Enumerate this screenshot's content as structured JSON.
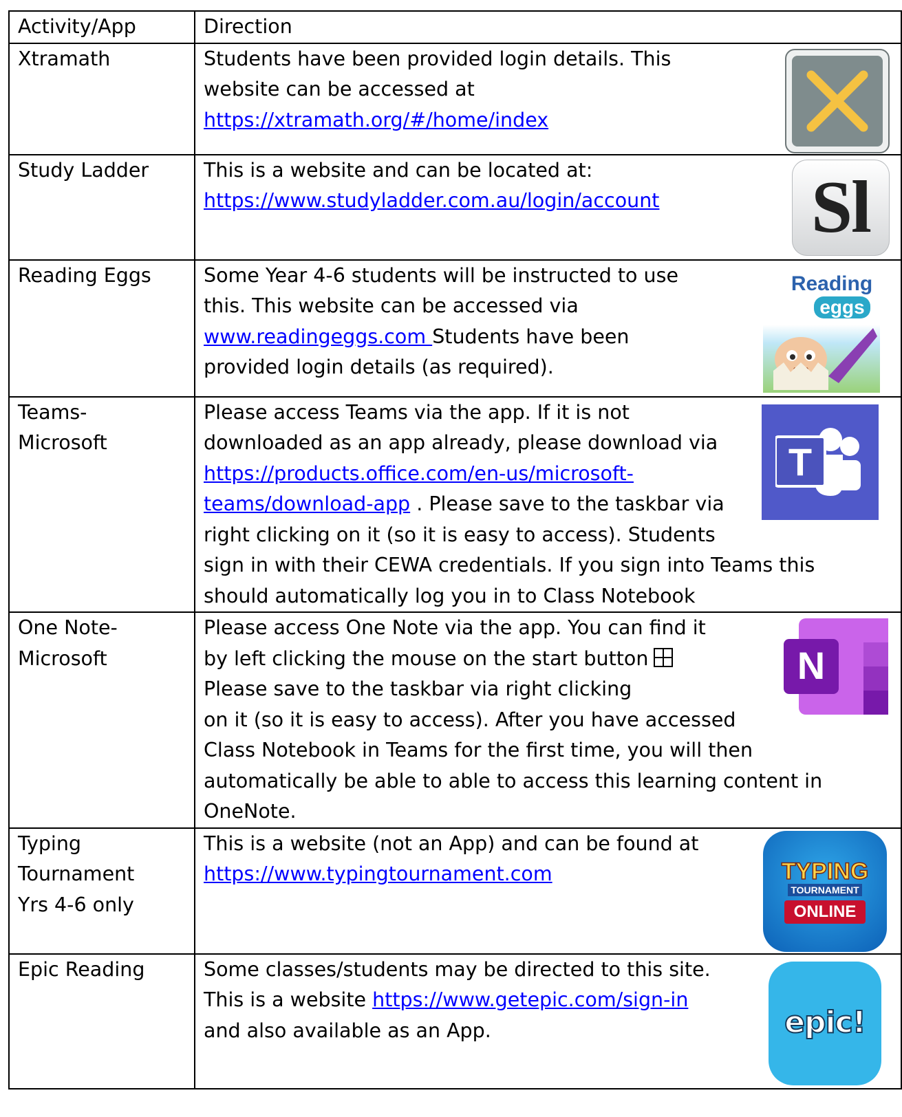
{
  "header": {
    "col1": "Activity/App",
    "col2": "Direction"
  },
  "rows": [
    {
      "app": "Xtramath",
      "lines": [
        "Students have been provided login details. This",
        "website can be accessed at"
      ],
      "link": "https://xtramath.org/#/home/index",
      "icon": "xtramath-logo-icon"
    },
    {
      "app": "Study Ladder",
      "lines": [
        "This is a website and can be located at:"
      ],
      "link": "https://www.studyladder.com.au/login/account",
      "icon": "studyladder-logo-icon",
      "icon_text": "Sl"
    },
    {
      "app": "Reading Eggs",
      "lines": [
        "Some Year 4-6 students will be instructed to use",
        "this. This website can be  accessed via"
      ],
      "link": "www.readingeggs.com ",
      "after_link": "Students have been",
      "tail": "provided login details (as required).",
      "icon": "reading-eggs-logo-icon",
      "icon_text_1": "Reading",
      "icon_text_2": "eggs"
    },
    {
      "app_line1": "Teams-",
      "app_line2": "Microsoft",
      "lines": [
        "Please access Teams via the app. If it is not",
        "downloaded as an app already, please download via"
      ],
      "link_1": "https://products.office.com/en-us/microsoft-",
      "link_2": "teams/download-app",
      "after_link": " . Please save to the taskbar via",
      "tail": [
        "right clicking on it (so it is easy to access). Students",
        "sign in with their CEWA credentials. If you sign into Teams this",
        "should automatically log you in to Class Notebook"
      ],
      "icon": "microsoft-teams-logo-icon",
      "icon_text": "T"
    },
    {
      "app_line1": "One Note-",
      "app_line2": "Microsoft",
      "line_1": "Please access One Note via the app. You can find it",
      "line_2": "by left clicking the mouse on the start button",
      "start_icon": "windows-start-icon",
      "tail": [
        "Please save to the taskbar via right clicking",
        "on it (so it is easy to access). After you have accessed",
        "Class Notebook in Teams for the first time, you will then",
        "automatically be able to able to access this learning content in",
        "OneNote."
      ],
      "icon": "onenote-logo-icon",
      "icon_text": "N"
    },
    {
      "app_lines": [
        "Typing",
        "Tournament",
        "Yrs 4-6 only"
      ],
      "lines": [
        "This is a website (not an App) and can be found at"
      ],
      "link": "https://www.typingtournament.com",
      "icon": "typing-tournament-logo-icon",
      "icon_text_1": "TYPING",
      "icon_text_2": "TOURNAMENT",
      "icon_text_3": "ONLINE"
    },
    {
      "app": "Epic Reading",
      "lines": [
        "Some classes/students may be directed to this site."
      ],
      "pre_link": "This is a website ",
      "link": "https://www.getepic.com/sign-in",
      "tail": "and also available as an App.",
      "icon": "epic-logo-icon",
      "icon_text": "epic!"
    }
  ],
  "colors": {
    "link": "#0000ff",
    "teams": "#5059c9",
    "onenote": "#7719aa",
    "epic": "#35b6e9",
    "xtramath_bg": "#7f8c8d",
    "xtramath_x": "#f5c242"
  }
}
